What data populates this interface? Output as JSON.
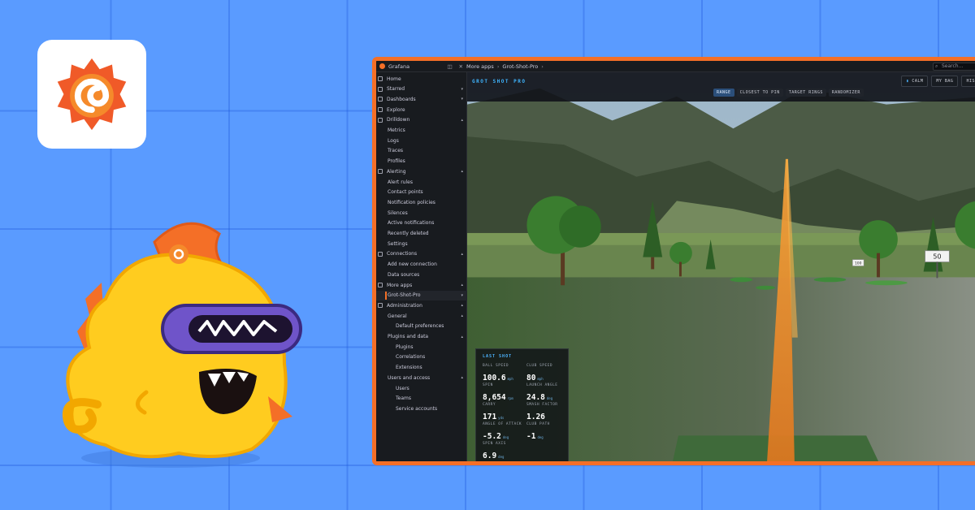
{
  "topbar": {
    "brand": "Grafana",
    "breadcrumbs": [
      "More apps",
      "Grot-Shot-Pro"
    ],
    "search_placeholder": "Search..."
  },
  "sidebar": {
    "items": [
      {
        "label": "Home",
        "level": 0,
        "chevron": ""
      },
      {
        "label": "Starred",
        "level": 0,
        "chevron": "▾"
      },
      {
        "label": "Dashboards",
        "level": 0,
        "chevron": "▾"
      },
      {
        "label": "Explore",
        "level": 0,
        "chevron": ""
      },
      {
        "label": "Drilldown",
        "level": 0,
        "chevron": "▴"
      },
      {
        "label": "Metrics",
        "level": 1,
        "chevron": ""
      },
      {
        "label": "Logs",
        "level": 1,
        "chevron": ""
      },
      {
        "label": "Traces",
        "level": 1,
        "chevron": ""
      },
      {
        "label": "Profiles",
        "level": 1,
        "chevron": ""
      },
      {
        "label": "Alerting",
        "level": 0,
        "chevron": "▴"
      },
      {
        "label": "Alert rules",
        "level": 1,
        "chevron": ""
      },
      {
        "label": "Contact points",
        "level": 1,
        "chevron": ""
      },
      {
        "label": "Notification policies",
        "level": 1,
        "chevron": ""
      },
      {
        "label": "Silences",
        "level": 1,
        "chevron": ""
      },
      {
        "label": "Active notifications",
        "level": 1,
        "chevron": ""
      },
      {
        "label": "Recently deleted",
        "level": 1,
        "chevron": ""
      },
      {
        "label": "Settings",
        "level": 1,
        "chevron": ""
      },
      {
        "label": "Connections",
        "level": 0,
        "chevron": "▴"
      },
      {
        "label": "Add new connection",
        "level": 1,
        "chevron": ""
      },
      {
        "label": "Data sources",
        "level": 1,
        "chevron": ""
      },
      {
        "label": "More apps",
        "level": 0,
        "chevron": "▴"
      },
      {
        "label": "Grot-Shot-Pro",
        "level": 1,
        "chevron": "▾",
        "active": true
      },
      {
        "label": "Administration",
        "level": 0,
        "chevron": "▴"
      },
      {
        "label": "General",
        "level": 1,
        "chevron": "▴"
      },
      {
        "label": "Default preferences",
        "level": 2,
        "chevron": ""
      },
      {
        "label": "Plugins and data",
        "level": 1,
        "chevron": "▴"
      },
      {
        "label": "Plugins",
        "level": 2,
        "chevron": ""
      },
      {
        "label": "Correlations",
        "level": 2,
        "chevron": ""
      },
      {
        "label": "Extensions",
        "level": 2,
        "chevron": ""
      },
      {
        "label": "Users and access",
        "level": 1,
        "chevron": "▴"
      },
      {
        "label": "Users",
        "level": 2,
        "chevron": ""
      },
      {
        "label": "Teams",
        "level": 2,
        "chevron": ""
      },
      {
        "label": "Service accounts",
        "level": 2,
        "chevron": ""
      }
    ]
  },
  "app": {
    "title": "GROT SHOT PRO",
    "modes": [
      "RANGE",
      "CLOSEST TO PIN",
      "TARGET RINGS",
      "RANDOMIZER"
    ],
    "active_mode": 0,
    "header_buttons": [
      "CALM",
      "MY BAG",
      "HISTO"
    ],
    "target_signs": [
      "50",
      "100"
    ]
  },
  "last_shot": {
    "title": "LAST SHOT",
    "stats": [
      {
        "label": "BALL SPEED",
        "value": "100.6",
        "unit": "mph"
      },
      {
        "label": "CLUB SPEED",
        "value": "80",
        "unit": "mph"
      },
      {
        "label": "SPIN",
        "value": "8,654",
        "unit": "rpm"
      },
      {
        "label": "LAUNCH ANGLE",
        "value": "24.8",
        "unit": "deg"
      },
      {
        "label": "CARRY",
        "value": "171",
        "unit": "yds"
      },
      {
        "label": "SMASH FACTOR",
        "value": "1.26",
        "unit": ""
      },
      {
        "label": "ANGLE OF ATTACK",
        "value": "-5.2",
        "unit": "deg"
      },
      {
        "label": "CLUB PATH",
        "value": "-1",
        "unit": "deg"
      },
      {
        "label": "SPIN AXIS",
        "value": "6.9",
        "unit": "deg"
      }
    ]
  },
  "colors": {
    "accent": "#f46f27",
    "background": "#5a9bff",
    "trajectory": "#f08a24",
    "mascot": "#ffcc1f"
  }
}
